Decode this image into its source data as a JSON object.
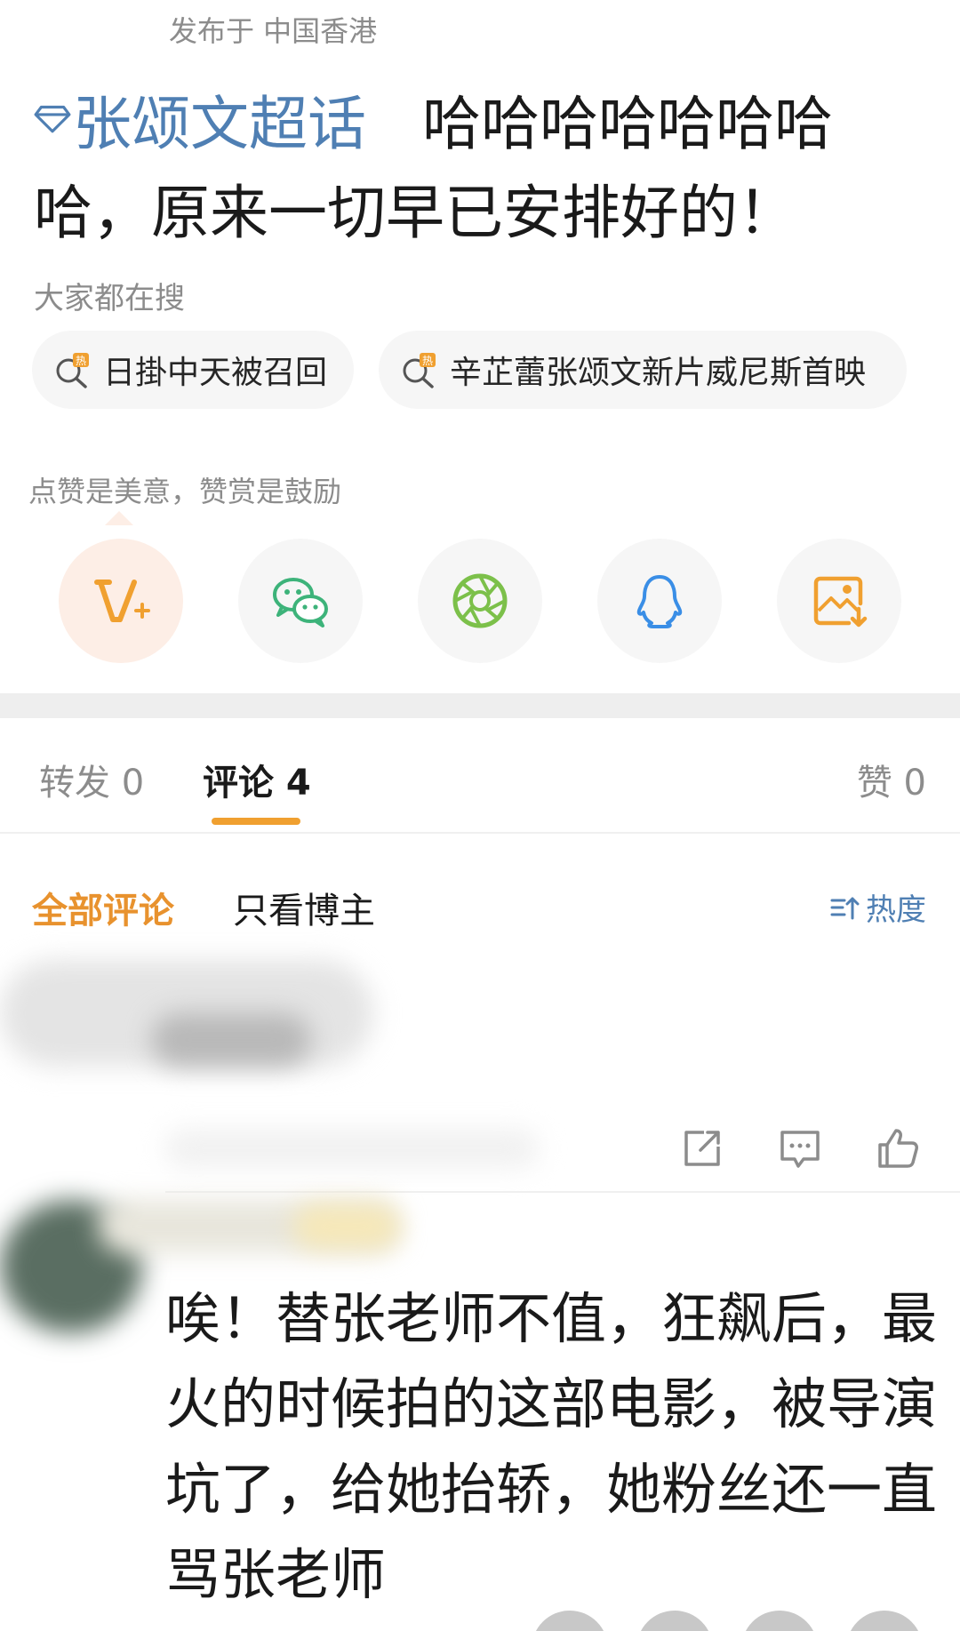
{
  "post": {
    "published": "发布于 中国香港",
    "topic": "张颂文超话",
    "body": "哈哈哈哈哈哈哈哈，原来一切早已安排好的！"
  },
  "search": {
    "label": "大家都在搜",
    "chips": [
      {
        "icon": "hot-search-icon",
        "text": "日掛中天被召回"
      },
      {
        "icon": "hot-search-icon",
        "text": "辛芷蕾张颂文新片威尼斯首映"
      }
    ]
  },
  "reward": {
    "tip": "点赞是美意，赞赏是鼓励"
  },
  "share": {
    "buttons": [
      "vip-reward-icon",
      "wechat-icon",
      "moments-icon",
      "qq-icon",
      "save-image-icon"
    ]
  },
  "tabs": {
    "repost": "转发 0",
    "comments": "评论 4",
    "likes": "赞 0"
  },
  "filters": {
    "all": "全部评论",
    "author_only": "只看博主",
    "sort": "热度"
  },
  "comment": {
    "text": "唉！替张老师不值，狂飙后，最火的时候拍的这部电影，被导演坑了，给她抬轿，她粉丝还一直骂张老师"
  },
  "colors": {
    "accent": "#e8922e",
    "link": "#4f7fb3",
    "muted": "#8c8c8c"
  }
}
